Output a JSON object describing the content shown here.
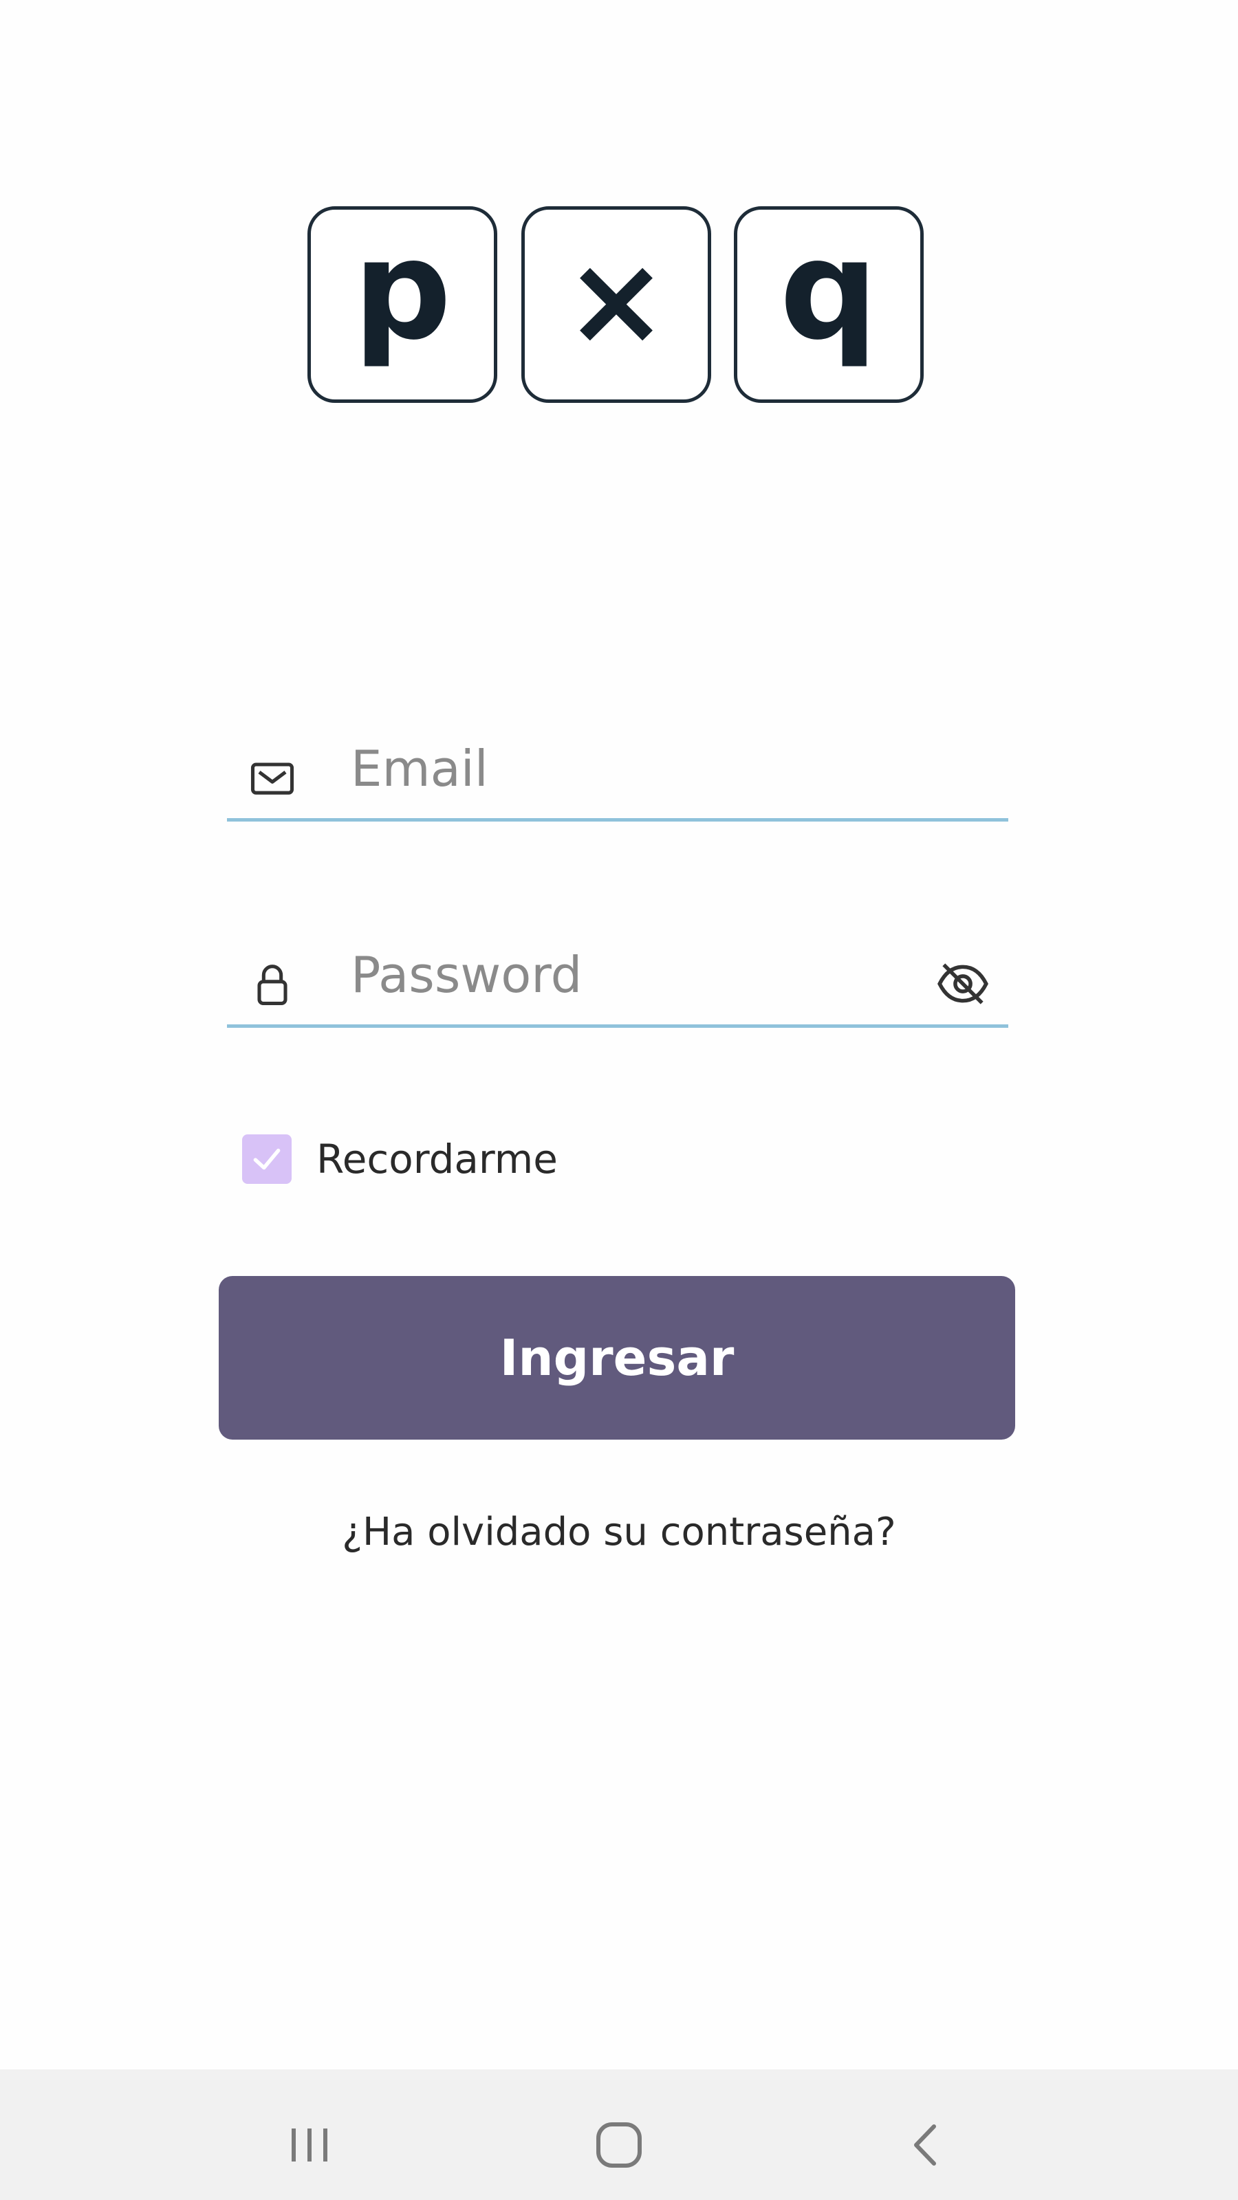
{
  "app": {
    "logo": {
      "letters": [
        "p",
        "×",
        "q"
      ],
      "tile_border_color": "#1e2c38"
    }
  },
  "login_form": {
    "email": {
      "placeholder": "Email",
      "value": "",
      "icon": "mail-icon"
    },
    "password": {
      "placeholder": "Password",
      "value": "",
      "icon": "lock-icon",
      "visibility_icon": "eye-off-icon"
    },
    "remember_me": {
      "label": "Recordarme",
      "checked": true
    },
    "submit_label": "Ingresar",
    "forgot_password_label": "¿Ha olvidado su contraseña?"
  },
  "system_nav": {
    "buttons": [
      "recents-icon",
      "home-icon",
      "back-icon"
    ]
  },
  "colors": {
    "primary_button": "#615a7d",
    "checkbox_fill": "#d8c2f7",
    "field_underline": "#8fc2db",
    "nav_bar": "#f1f1f1"
  }
}
